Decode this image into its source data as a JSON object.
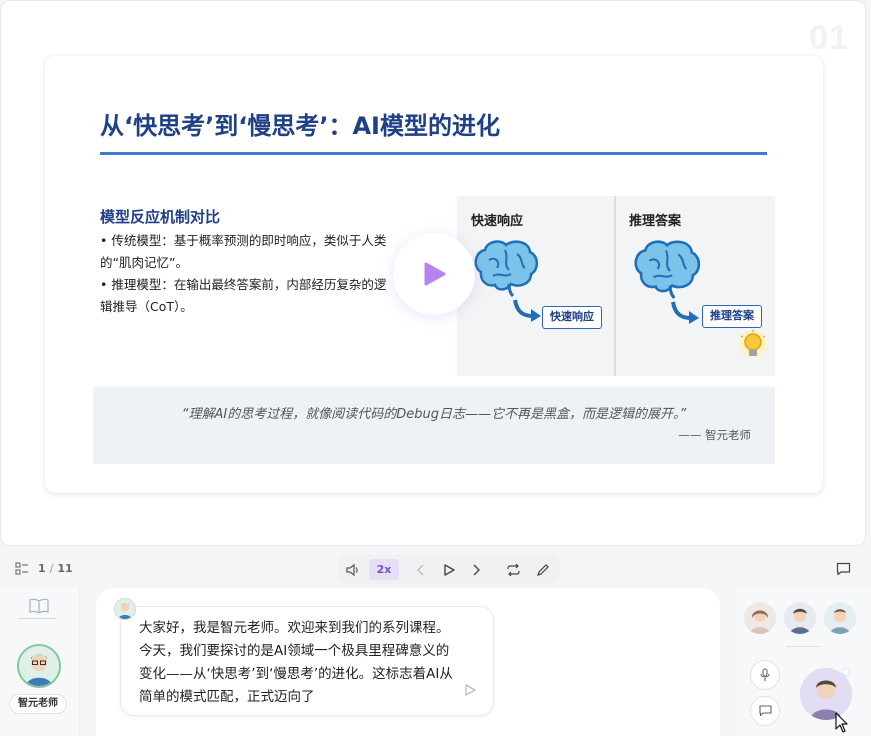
{
  "slide": {
    "number": "01",
    "title": "从‘快思考’到‘慢思考’：AI模型的进化",
    "section_heading": "模型反应机制对比",
    "bullets": [
      "• 传统模型：基于概率预测的即时响应，类似于人类的“肌肉记忆”。",
      "• 推理模型：在输出最终答案前，内部经历复杂的逻辑推导（CoT）。"
    ],
    "panel_left": {
      "label": "快速响应",
      "box": "快速响应"
    },
    "panel_right": {
      "label": "推理答案",
      "box": "推理答案"
    },
    "quote": "“理解AI的思考过程，就像阅读代码的Debug日志——它不再是黑盒，而是逻辑的展开。”",
    "quote_author": "—— 智元老师"
  },
  "toolbar": {
    "page_current": "1",
    "page_total": "11",
    "speed": "2x"
  },
  "teacher": {
    "name": "智元老师"
  },
  "chat": {
    "message": "大家好，我是智元老师。欢迎来到我们的系列课程。今天，我们要探讨的是AI领域一个极具里程碑意义的变化——从‘快思考’到‘慢思考’的进化。这标志着AI从简单的模式匹配，正式迈向了"
  },
  "icons": {
    "outline": "outline-icon",
    "volume": "volume-icon",
    "prev": "chevron-left-icon",
    "play": "play-icon",
    "next": "chevron-right-icon",
    "loop": "loop-icon",
    "pen": "pen-icon",
    "comment": "comment-icon",
    "book": "book-icon",
    "mic": "mic-icon"
  },
  "colors": {
    "title": "#1f3f86",
    "accent": "#3f7ad8",
    "speed_badge": "#7352c7",
    "play": "#b883f0"
  }
}
